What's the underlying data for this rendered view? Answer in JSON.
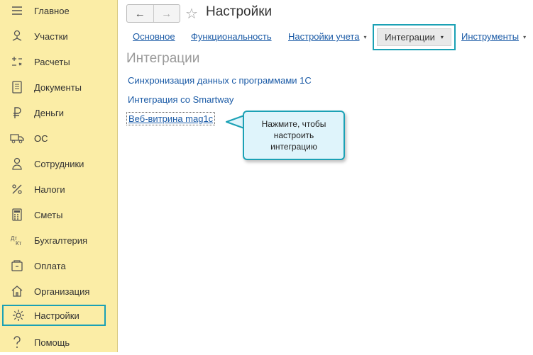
{
  "sidebar": {
    "items": [
      {
        "label": "Главное",
        "icon": "menu-icon"
      },
      {
        "label": "Участки",
        "icon": "hierarchy-icon"
      },
      {
        "label": "Расчеты",
        "icon": "calculator-icon"
      },
      {
        "label": "Документы",
        "icon": "document-icon"
      },
      {
        "label": "Деньги",
        "icon": "ruble-icon"
      },
      {
        "label": "ОС",
        "icon": "truck-icon"
      },
      {
        "label": "Сотрудники",
        "icon": "person-icon"
      },
      {
        "label": "Налоги",
        "icon": "percent-icon"
      },
      {
        "label": "Сметы",
        "icon": "calc-grid-icon"
      },
      {
        "label": "Бухгалтерия",
        "icon": "dt-kt-icon",
        "icon_text": {
          "dt": "Дт",
          "kt": "Кт"
        }
      },
      {
        "label": "Оплата",
        "icon": "payment-icon"
      },
      {
        "label": "Организация",
        "icon": "building-icon"
      },
      {
        "label": "Настройки",
        "icon": "gear-icon",
        "active": true
      },
      {
        "label": "Помощь",
        "icon": "question-icon"
      }
    ]
  },
  "header": {
    "title": "Настройки",
    "back": "←",
    "forward": "→",
    "star": "☆"
  },
  "tabs": [
    {
      "label": "Основное"
    },
    {
      "label": "Функциональность"
    },
    {
      "label": "Настройки учета",
      "dropdown": true
    },
    {
      "label": "Интеграции",
      "dropdown": true,
      "active": true
    },
    {
      "label": "Инструменты",
      "dropdown": true
    }
  ],
  "caret": "▾",
  "section": {
    "title": "Интеграции",
    "links": [
      {
        "label": "Синхронизация данных с программами 1С"
      },
      {
        "label": "Интеграция со Smartway"
      },
      {
        "label": "Веб-витрина mag1c"
      }
    ]
  },
  "tooltip": {
    "lines": [
      "Нажмите, чтобы",
      "настроить",
      "интеграцию"
    ]
  },
  "colors": {
    "sidebar_bg": "#fbeda6",
    "highlight": "#1ba1b5",
    "link": "#1a5aa6",
    "tooltip_bg": "#dff4fb"
  }
}
